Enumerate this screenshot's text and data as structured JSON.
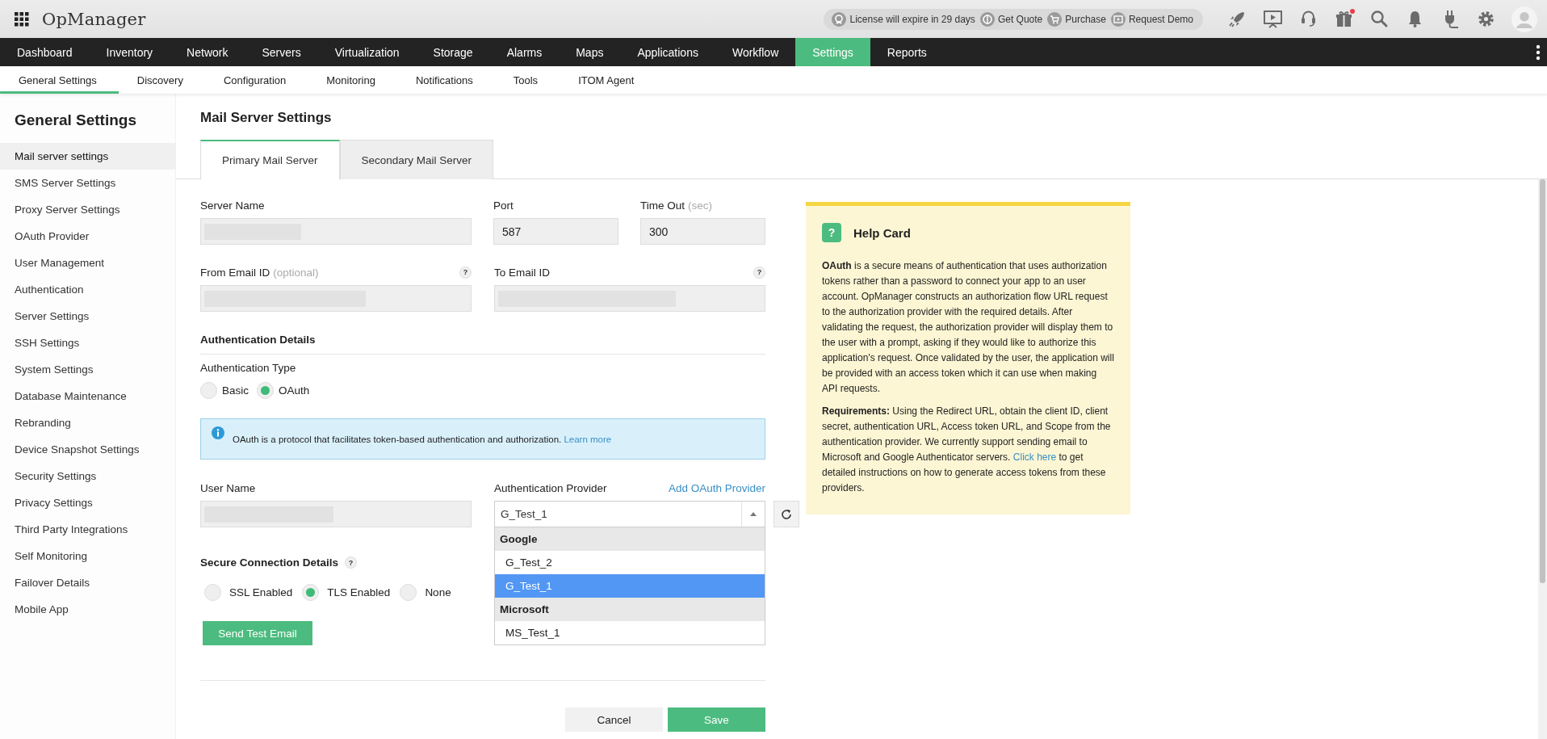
{
  "app": {
    "title": "OpManager"
  },
  "topbar": {
    "notices": [
      {
        "kind": "license",
        "label": "License will expire in 29 days"
      },
      {
        "kind": "quote",
        "label": "Get Quote"
      },
      {
        "kind": "cart",
        "label": "Purchase"
      },
      {
        "kind": "demo",
        "label": "Request Demo"
      }
    ],
    "icons": [
      {
        "kind": "rocket",
        "badge": false
      },
      {
        "kind": "presentation",
        "badge": false
      },
      {
        "kind": "headset",
        "badge": false
      },
      {
        "kind": "gift",
        "badge": true
      },
      {
        "kind": "search",
        "badge": false
      },
      {
        "kind": "bell",
        "badge": false
      },
      {
        "kind": "plug",
        "badge": false
      },
      {
        "kind": "settings",
        "badge": false
      },
      {
        "kind": "avatar",
        "badge": false
      }
    ]
  },
  "nav": [
    {
      "label": "Dashboard",
      "selected": false
    },
    {
      "label": "Inventory",
      "selected": false
    },
    {
      "label": "Network",
      "selected": false
    },
    {
      "label": "Servers",
      "selected": false
    },
    {
      "label": "Virtualization",
      "selected": false
    },
    {
      "label": "Storage",
      "selected": false
    },
    {
      "label": "Alarms",
      "selected": false
    },
    {
      "label": "Maps",
      "selected": false
    },
    {
      "label": "Applications",
      "selected": false
    },
    {
      "label": "Workflow",
      "selected": false
    },
    {
      "label": "Settings",
      "selected": true
    },
    {
      "label": "Reports",
      "selected": false
    }
  ],
  "subnav": [
    {
      "label": "General Settings",
      "selected": true
    },
    {
      "label": "Discovery",
      "selected": false
    },
    {
      "label": "Configuration",
      "selected": false
    },
    {
      "label": "Monitoring",
      "selected": false
    },
    {
      "label": "Notifications",
      "selected": false
    },
    {
      "label": "Tools",
      "selected": false
    },
    {
      "label": "ITOM Agent",
      "selected": false
    }
  ],
  "sidebar": {
    "title": "General Settings",
    "items": [
      {
        "label": "Mail server settings",
        "selected": true
      },
      {
        "label": "SMS Server Settings",
        "selected": false
      },
      {
        "label": "Proxy Server Settings",
        "selected": false
      },
      {
        "label": "OAuth Provider",
        "selected": false
      },
      {
        "label": "User Management",
        "selected": false
      },
      {
        "label": "Authentication",
        "selected": false
      },
      {
        "label": "Server Settings",
        "selected": false
      },
      {
        "label": "SSH Settings",
        "selected": false
      },
      {
        "label": "System Settings",
        "selected": false
      },
      {
        "label": "Database Maintenance",
        "selected": false
      },
      {
        "label": "Rebranding",
        "selected": false
      },
      {
        "label": "Device Snapshot Settings",
        "selected": false
      },
      {
        "label": "Security Settings",
        "selected": false
      },
      {
        "label": "Privacy Settings",
        "selected": false
      },
      {
        "label": "Third Party Integrations",
        "selected": false
      },
      {
        "label": "Self Monitoring",
        "selected": false
      },
      {
        "label": "Failover Details",
        "selected": false
      },
      {
        "label": "Mobile App",
        "selected": false
      }
    ]
  },
  "page": {
    "title": "Mail Server Settings",
    "tabs": [
      {
        "label": "Primary Mail Server",
        "selected": true
      },
      {
        "label": "Secondary Mail Server",
        "selected": false
      }
    ]
  },
  "form": {
    "server_name": {
      "label": "Server Name"
    },
    "port": {
      "label": "Port",
      "value": "587"
    },
    "timeout": {
      "label": "Time Out",
      "hint": "(sec)",
      "value": "300"
    },
    "from_email": {
      "label": "From Email ID",
      "hint": "(optional)",
      "help": "?"
    },
    "to_email": {
      "label": "To Email ID",
      "help": "?"
    },
    "auth_title": "Authentication Details",
    "auth_type": {
      "label": "Authentication Type",
      "options": [
        {
          "label": "Basic",
          "selected": false
        },
        {
          "label": "OAuth",
          "selected": true
        }
      ]
    },
    "info": {
      "text": "OAuth is a protocol that facilitates token-based authentication and authorization.",
      "link": "Learn more"
    },
    "user_name": {
      "label": "User Name"
    },
    "provider": {
      "label": "Authentication Provider",
      "link": "Add OAuth Provider",
      "value": "G_Test_1",
      "expanded": true,
      "groups": [
        {
          "label": "Google",
          "options": [
            {
              "label": "G_Test_2",
              "selected": false
            },
            {
              "label": "G_Test_1",
              "selected": true
            }
          ]
        },
        {
          "label": "Microsoft",
          "options": [
            {
              "label": "MS_Test_1",
              "selected": false
            }
          ]
        }
      ]
    },
    "secure": {
      "title": "Secure Connection Details",
      "help": "?",
      "options": [
        {
          "label": "SSL Enabled",
          "selected": false
        },
        {
          "label": "TLS Enabled",
          "selected": true
        },
        {
          "label": "None",
          "selected": false
        }
      ]
    },
    "send_button": "Send Test Email",
    "cancel_button": "Cancel",
    "save_button": "Save"
  },
  "help_card": {
    "icon": "?",
    "title": "Help Card",
    "paragraphs": [
      {
        "text": "**OAuth** is a secure means of authentication that uses authorization tokens rather than a password to connect your app to an user account. OpManager constructs an authorization flow URL request to the authorization provider with the required details. After validating the request, the authorization provider will display them to the user with a prompt, asking if they would like to authorize this application's request. Once validated by the user, the application will be provided with an access token which it can use when making API requests."
      },
      {
        "text": "**Requirements:** Using the Redirect URL, obtain the client ID, client secret, authentication URL, Access token URL, and Scope from the authentication provider. We currently support sending email to Microsoft and Google Authenticator servers.",
        "link": "Click here",
        "after": "to get detailed instructions on how to generate access tokens from these providers."
      }
    ]
  }
}
